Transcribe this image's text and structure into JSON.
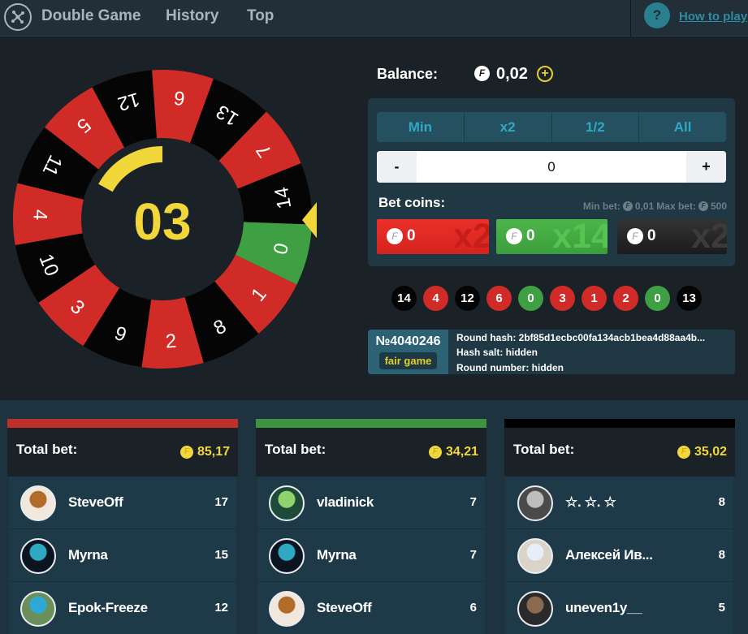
{
  "header": {
    "nav": [
      "Double Game",
      "History",
      "Top"
    ],
    "help_icon": "?",
    "help_link": "How to play"
  },
  "wheel": {
    "countdown": "03",
    "timer_remaining_fraction": 0.17,
    "segments": [
      {
        "number": "0",
        "color": "green"
      },
      {
        "number": "1",
        "color": "red"
      },
      {
        "number": "8",
        "color": "black"
      },
      {
        "number": "2",
        "color": "red"
      },
      {
        "number": "9",
        "color": "black"
      },
      {
        "number": "3",
        "color": "red"
      },
      {
        "number": "10",
        "color": "black"
      },
      {
        "number": "4",
        "color": "red"
      },
      {
        "number": "11",
        "color": "black"
      },
      {
        "number": "5",
        "color": "red"
      },
      {
        "number": "12",
        "color": "black"
      },
      {
        "number": "6",
        "color": "red"
      },
      {
        "number": "13",
        "color": "black"
      },
      {
        "number": "7",
        "color": "red"
      },
      {
        "number": "14",
        "color": "black"
      }
    ],
    "colors": {
      "red": "#d12b27",
      "black": "#050505",
      "green": "#3f9f43",
      "accent": "#f2d73a"
    }
  },
  "balance": {
    "label": "Balance:",
    "coin": "F",
    "value": "0,02",
    "add_icon": "+"
  },
  "bet": {
    "quick_buttons": [
      "Min",
      "x2",
      "1/2",
      "All"
    ],
    "minus": "-",
    "amount": "0",
    "plus": "+",
    "bet_coins_label": "Bet coins:",
    "min_bet_label": "Min bet:",
    "min_bet_value": "0,01",
    "max_bet_label": "Max bet:",
    "max_bet_value": "500",
    "coin": "F",
    "options": [
      {
        "color": "red",
        "amount": "0",
        "multiplier": "x2"
      },
      {
        "color": "green",
        "amount": "0",
        "multiplier": "x14"
      },
      {
        "color": "black",
        "amount": "0",
        "multiplier": "x2"
      }
    ]
  },
  "history": [
    {
      "number": "14",
      "color": "black"
    },
    {
      "number": "4",
      "color": "red"
    },
    {
      "number": "12",
      "color": "black"
    },
    {
      "number": "6",
      "color": "red"
    },
    {
      "number": "0",
      "color": "green"
    },
    {
      "number": "3",
      "color": "red"
    },
    {
      "number": "1",
      "color": "red"
    },
    {
      "number": "2",
      "color": "red"
    },
    {
      "number": "0",
      "color": "green"
    },
    {
      "number": "13",
      "color": "black"
    }
  ],
  "round": {
    "id": "№4040246",
    "fair_badge": "fair game",
    "hash_line": "Round hash: 2bf85d1ecbc00fa134acb1bea4d88aa4b...",
    "salt_line": "Hash salt: hidden",
    "number_line": "Round number: hidden"
  },
  "columns": [
    {
      "color": "#c0302b",
      "total_label": "Total bet:",
      "coin": "F",
      "total": "85,17",
      "players": [
        {
          "name": "SteveOff",
          "count": "17",
          "avatar": "cowboy"
        },
        {
          "name": "Myrna",
          "count": "15",
          "avatar": "mask"
        },
        {
          "name": "Epok-Freeze",
          "count": "12",
          "avatar": "turtle"
        }
      ]
    },
    {
      "color": "#3f9240",
      "total_label": "Total bet:",
      "coin": "F",
      "total": "34,21",
      "players": [
        {
          "name": "vladinick",
          "count": "7",
          "avatar": "monster"
        },
        {
          "name": "Myrna",
          "count": "7",
          "avatar": "mask"
        },
        {
          "name": "SteveOff",
          "count": "6",
          "avatar": "cowboy"
        }
      ]
    },
    {
      "color": "#000000",
      "total_label": "Total bet:",
      "coin": "F",
      "total": "35,02",
      "players": [
        {
          "name": "☆. ☆. ☆",
          "count": "8",
          "avatar": "gasmask"
        },
        {
          "name": "Алексей Ив...",
          "count": "8",
          "avatar": "man-shirt"
        },
        {
          "name": "uneven1y__",
          "count": "5",
          "avatar": "man-dark"
        }
      ]
    }
  ]
}
